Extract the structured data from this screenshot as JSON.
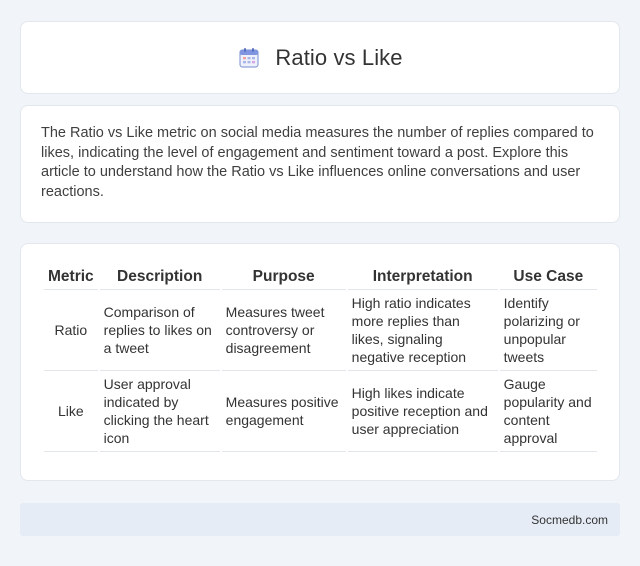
{
  "header": {
    "title": "Ratio vs Like",
    "icon": "calendar-icon"
  },
  "intro": {
    "text": "The Ratio vs Like metric on social media measures the number of replies compared to likes, indicating the level of engagement and sentiment toward a post. Explore this article to understand how the Ratio vs Like influences online conversations and user reactions."
  },
  "table": {
    "headers": [
      "Metric",
      "Description",
      "Purpose",
      "Interpretation",
      "Use Case"
    ],
    "rows": [
      [
        "Ratio",
        "Comparison of replies to likes on a tweet",
        "Measures tweet controversy or disagreement",
        "High ratio indicates more replies than likes, signaling negative reception",
        "Identify polarizing or unpopular tweets"
      ],
      [
        "Like",
        "User approval indicated by clicking the heart icon",
        "Measures positive engagement",
        "High likes indicate positive reception and user appreciation",
        "Gauge popularity and content approval"
      ]
    ]
  },
  "footer": {
    "site": "Socmedb.com"
  },
  "colors": {
    "page_bg": "#f1f4f9",
    "card_bg": "#ffffff",
    "footer_bg": "#e6ecf6"
  }
}
